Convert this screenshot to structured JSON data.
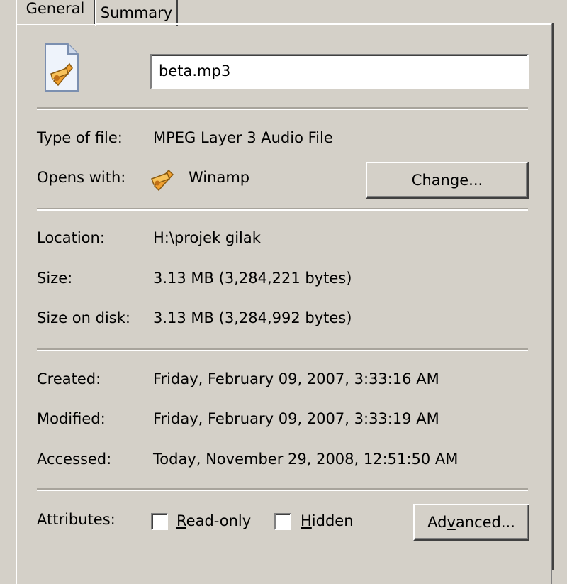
{
  "tabs": [
    {
      "label": "General",
      "active": true
    },
    {
      "label": "Summary",
      "active": false
    }
  ],
  "file": {
    "name": "beta.mp3",
    "icon": "mp3-file-icon"
  },
  "type_of_file": {
    "label": "Type of file:",
    "value": "MPEG Layer 3 Audio File"
  },
  "opens_with": {
    "label": "Opens with:",
    "app": "Winamp",
    "app_icon": "winamp-icon",
    "change_button": "Change..."
  },
  "location": {
    "label": "Location:",
    "value": "H:\\projek gilak"
  },
  "size": {
    "label": "Size:",
    "value": "3.13 MB (3,284,221 bytes)"
  },
  "size_on_disk": {
    "label": "Size on disk:",
    "value": "3.13 MB (3,284,992 bytes)"
  },
  "created": {
    "label": "Created:",
    "value": "Friday, February 09, 2007, 3:33:16 AM"
  },
  "modified": {
    "label": "Modified:",
    "value": "Friday, February 09, 2007, 3:33:19 AM"
  },
  "accessed": {
    "label": "Accessed:",
    "value": "Today, November 29, 2008, 12:51:50 AM"
  },
  "attributes": {
    "label": "Attributes:",
    "read_only": {
      "label_mnemonic": "R",
      "label_rest": "ead-only",
      "checked": false
    },
    "hidden": {
      "label_mnemonic": "H",
      "label_rest": "idden",
      "checked": false
    },
    "advanced_prefix": "Ad",
    "advanced_mnemonic": "v",
    "advanced_rest": "anced..."
  },
  "colors": {
    "face": "#d4d0c8",
    "shadow": "#808080",
    "highlight": "#ffffff"
  }
}
